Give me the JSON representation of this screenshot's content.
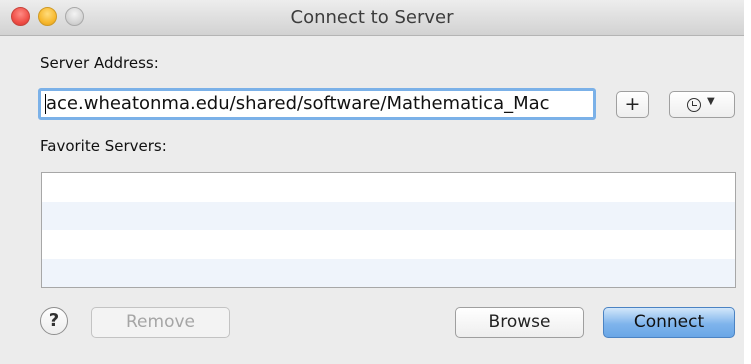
{
  "window": {
    "title": "Connect to Server"
  },
  "server_address": {
    "label": "Server Address:",
    "value": "ace.wheatonma.edu/shared/software/Mathematica_Mac"
  },
  "buttons": {
    "add_label": "+",
    "help_label": "?",
    "remove_label": "Remove",
    "browse_label": "Browse",
    "connect_label": "Connect"
  },
  "favorites": {
    "label": "Favorite Servers:",
    "items": []
  },
  "icons": {
    "history": "clock-icon",
    "history_menu": "chevron-down-icon"
  },
  "colors": {
    "focus_ring": "#7bb1e8",
    "default_button": "#7fb4ec",
    "close": "#ee4b43",
    "minimize": "#f6b62a"
  }
}
